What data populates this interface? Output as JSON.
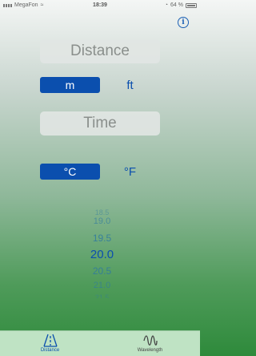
{
  "status_bar": {
    "carrier": "MegaFon",
    "time": "18:39",
    "battery": "64 %"
  },
  "header": {
    "info_icon_glyph": "i"
  },
  "distance": {
    "placeholder": "Distance",
    "unit_selected": "m",
    "unit_other": "ft"
  },
  "time_field": {
    "placeholder": "Time"
  },
  "temperature": {
    "unit_selected": "°C",
    "unit_other": "°F"
  },
  "picker": {
    "items": [
      "18.5",
      "19.0",
      "19.5",
      "20.0",
      "20.5",
      "21.0",
      "21.5"
    ],
    "selected_index": 3
  },
  "tab_bar": {
    "tabs": [
      {
        "label": "Distance",
        "icon": "road-icon",
        "active": true
      },
      {
        "label": "Wavelength",
        "icon": "sine-wave-icon",
        "active": false
      }
    ]
  },
  "colors": {
    "accent": "#0b4fae",
    "tab_bar_bg": "#bfe3c4",
    "gradient_bottom": "#2e8a3b"
  }
}
